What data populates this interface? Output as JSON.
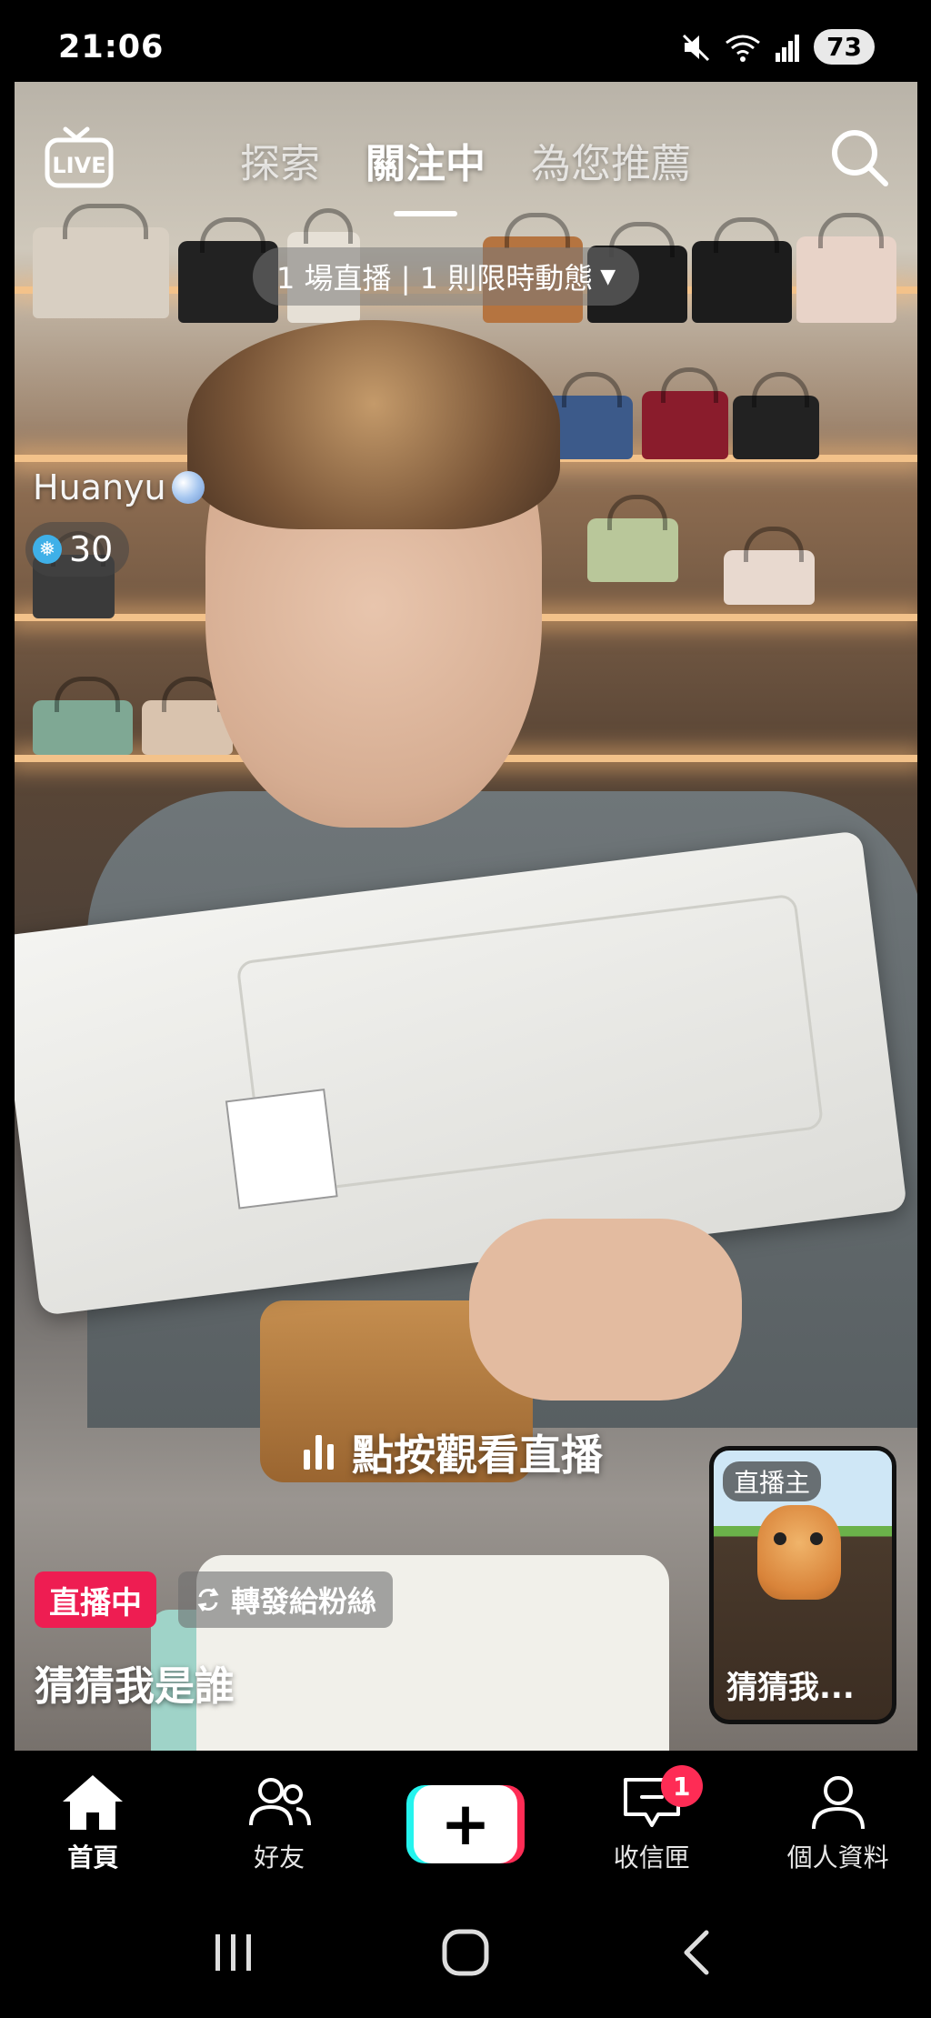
{
  "status_bar": {
    "time": "21:06",
    "battery": "73"
  },
  "top_nav": {
    "live_icon_label": "LIVE",
    "tabs": [
      {
        "label": "探索",
        "active": false
      },
      {
        "label": "關注中",
        "active": true
      },
      {
        "label": "為您推薦",
        "active": false
      }
    ]
  },
  "live_pill": {
    "label": "1 場直播 | 1 則限時動態",
    "caret": "▼"
  },
  "host": {
    "name": "Huanyu",
    "viewer_count": "30"
  },
  "center_action": {
    "label": "點按觀看直播"
  },
  "bottom_info": {
    "live_badge": "直播中",
    "repost_label": "轉發給粉絲",
    "stream_title": "猜猜我是誰"
  },
  "host_card": {
    "label": "直播主",
    "name": "猜猜我..."
  },
  "bottom_nav": {
    "items": [
      {
        "label": "首頁",
        "icon": "home-icon",
        "active": true
      },
      {
        "label": "好友",
        "icon": "friends-icon",
        "active": false
      },
      {
        "label": "",
        "icon": "plus-icon",
        "active": false
      },
      {
        "label": "收信匣",
        "icon": "inbox-icon",
        "active": false,
        "badge": "1"
      },
      {
        "label": "個人資料",
        "icon": "profile-icon",
        "active": false
      }
    ]
  },
  "colors": {
    "live_red": "#ee1d52",
    "accent_cyan": "#25f4ee",
    "accent_pink": "#fe2c55"
  }
}
